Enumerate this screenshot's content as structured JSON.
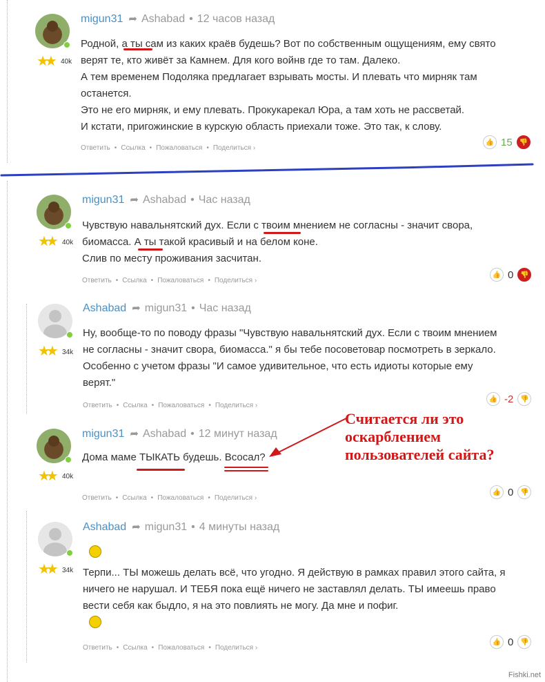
{
  "comments": [
    {
      "author": "migun31",
      "reply_to": "Ashabad",
      "time": "12 часов назад",
      "rating": "40k",
      "avatar": "bear",
      "body": "Родной, а ты сам из каких краёв будешь? Вот по собственным ощущениям, ему свято\nверят те, кто живёт за Камнем. Для кого войнв где то там. Далеко.\nА тем временем Подоляка предлагает взрывать мосты. И плевать что мирняк там\nостанется.\nЭто не его мирняк, и ему плевать. Прокукарекал Юра, а там хоть не рассветай.\nИ кстати, пригожинские в курскую область приехали тоже. Это так, к слову.",
      "score": "15"
    },
    {
      "author": "migun31",
      "reply_to": "Ashabad",
      "time": "Час назад",
      "rating": "40k",
      "avatar": "bear",
      "body": "Чувствую навальнятский дух. Если с твоим мнением не согласны - значит свора,\nбиомасса. А ты такой красивый и на белом коне.\nСлив по месту проживания засчитан.",
      "score": "0"
    },
    {
      "author": "Ashabad",
      "reply_to": "migun31",
      "time": "Час назад",
      "rating": "34k",
      "avatar": "default",
      "body": "Ну, вообще-то по поводу фразы \"Чувствую навальнятский дух. Если с твоим мнением\nне согласны - значит свора, биомасса.\" я бы тебе посоветовар посмотреть в зеркало.\nОсобенно с учетом фразы \"И самое удивительное, что есть идиоты которые ему\nверят.\"",
      "score": "-2"
    },
    {
      "author": "migun31",
      "reply_to": "Ashabad",
      "time": "12 минут назад",
      "rating": "40k",
      "avatar": "bear",
      "body": "Дома маме ТЫКАТЬ будешь.  Всосал?",
      "score": "0"
    },
    {
      "author": "Ashabad",
      "reply_to": "migun31",
      "time": "4 минуты назад",
      "rating": "34k",
      "avatar": "default",
      "body": "Терпи... ТЫ можешь делать всё, что угодно. Я действую в рамках правил этого сайта, я\nничего не нарушал. И ТЕБЯ пока ещё ничего не заставлял делать. ТЫ имеешь право\nвести себя как быдло, я на это повлиять не могу. Да мне и пофиг.",
      "score": "0"
    }
  ],
  "actions": {
    "reply": "Ответить",
    "link": "Ссылка",
    "report": "Пожаловаться",
    "share": "Поделиться ›"
  },
  "annotation": {
    "text": "Считается ли это\nоскарблением\nпользователей сайта?",
    "color": "#d01818"
  },
  "watermark": "Fishki.net",
  "colors": {
    "author": "#4a90c4",
    "separator": "#2b3fbf",
    "underline": "#d01818"
  }
}
